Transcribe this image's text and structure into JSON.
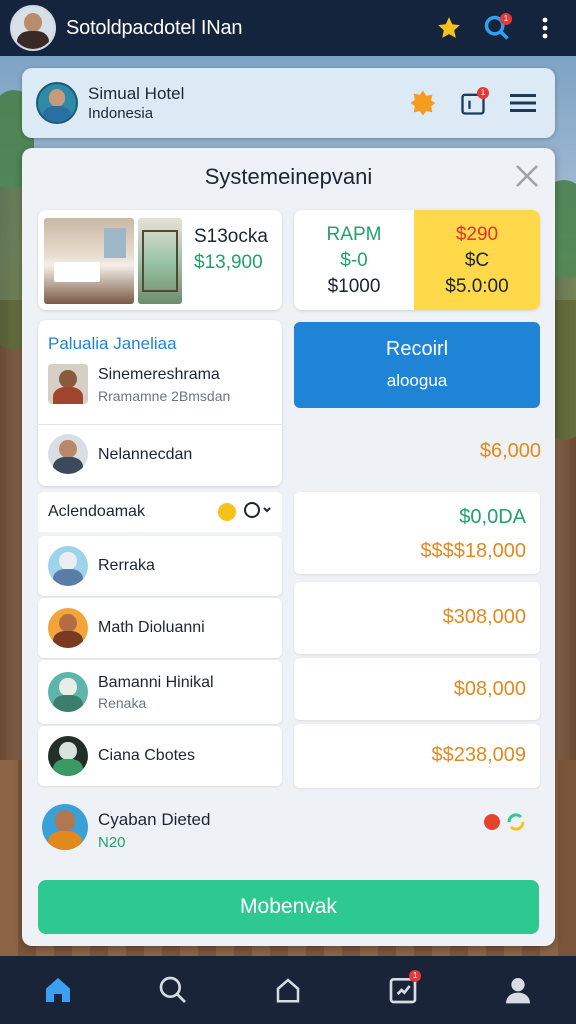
{
  "topbar": {
    "title": "Sotoldpacdotel INan",
    "notification_count": "1"
  },
  "hotel": {
    "name": "Simual Hotel",
    "location": "Indonesia",
    "notification_count": "1"
  },
  "panel": {
    "title": "Systemeinepvani"
  },
  "room": {
    "name": "S13ocka",
    "price": "$13,900"
  },
  "rates": {
    "col1_header": "RAPM",
    "col1_value": "$-0",
    "col1_total": "$1000",
    "col2_header": "$290",
    "col2_value": "$C",
    "col2_total": "$5.0:00"
  },
  "guest_section": {
    "title": "Palualia Janeliaa",
    "guest1_name": "Sinemereshrama",
    "guest1_sub": "Rramamne 2Bmsdan",
    "guest2_name": "Nelannecdan"
  },
  "report_button": {
    "line1": "Recoirl",
    "line2": "aloogua"
  },
  "amounts": {
    "a0": "$6,000",
    "a1_top": "$0,0DA",
    "a1_bottom": "$$$$18,000",
    "a2": "$308,000",
    "a3": "$08,000",
    "a4": "$$238,009"
  },
  "list": {
    "header": "Aclendoamak",
    "rows": [
      {
        "name": "Rerraka",
        "sub": ""
      },
      {
        "name": "Math Dioluanni",
        "sub": ""
      },
      {
        "name": "Bamanni Hinikal",
        "sub": "Renaka"
      },
      {
        "name": "Ciana Cbotes",
        "sub": ""
      }
    ]
  },
  "footer_user": {
    "name": "Cyaban Dieted",
    "sub": "N20"
  },
  "cta": {
    "label": "Mobenvak"
  },
  "nav": {
    "notification_count": "1"
  },
  "colors": {
    "accent_green": "#2ec991",
    "report_blue": "#1f84d6",
    "highlight_yellow": "#ffd94a",
    "amount_orange": "#e08a1e",
    "topbar": "#15243d"
  }
}
